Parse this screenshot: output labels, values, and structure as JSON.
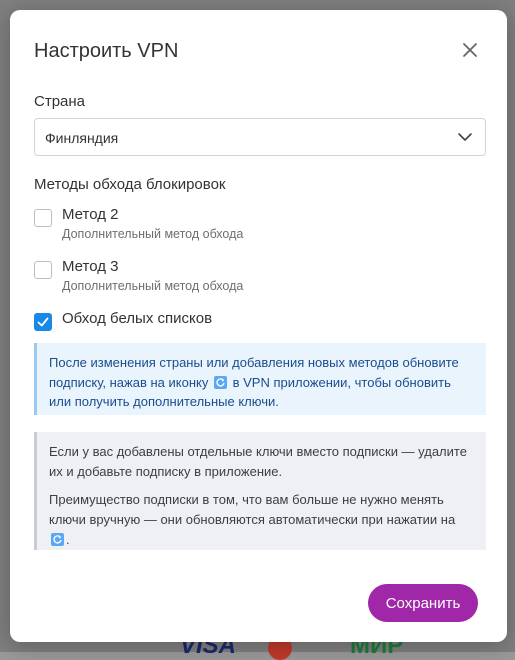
{
  "modal": {
    "title": "Настроить VPN"
  },
  "country": {
    "label": "Страна",
    "selected": "Финляндия"
  },
  "methods": {
    "label": "Методы обхода блокировок",
    "items": [
      {
        "title": "Метод 2",
        "subtitle": "Дополнительный метод обхода",
        "checked": false
      },
      {
        "title": "Метод 3",
        "subtitle": "Дополнительный метод обхода",
        "checked": false
      },
      {
        "title": "Обход белых списков",
        "subtitle": "",
        "checked": true
      }
    ]
  },
  "info": {
    "part1": "После изменения страны или добавления новых методов обновите подписку, нажав на иконку",
    "part2": "в VPN приложении, чтобы обновить или получить дополнительные ключи."
  },
  "note": {
    "para1": "Если у вас добавлены отдельные ключи вместо подписки — удалите их и добавьте подписку в приложение.",
    "para2": "Преимущество подписки в том, что вам больше не нужно менять ключи вручную — они обновляются автоматически при нажатии на",
    "para2_end": "."
  },
  "actions": {
    "save_label": "Сохранить"
  },
  "colors": {
    "accent": "#a127a9",
    "checkbox": "#1a88e6",
    "info_bg": "#eaf4fd"
  }
}
